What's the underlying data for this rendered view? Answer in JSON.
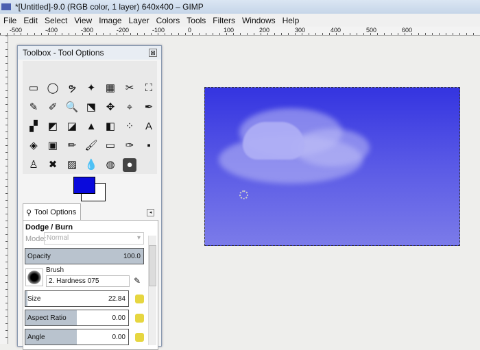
{
  "window": {
    "title": "*[Untitled]-9.0 (RGB color, 1 layer) 640x400 – GIMP"
  },
  "menu": [
    "File",
    "Edit",
    "Select",
    "View",
    "Image",
    "Layer",
    "Colors",
    "Tools",
    "Filters",
    "Windows",
    "Help"
  ],
  "ruler": {
    "labels": [
      "-500",
      "-400",
      "-300",
      "-200",
      "-100",
      "0",
      "100",
      "200",
      "300",
      "400",
      "500",
      "600"
    ]
  },
  "toolbox": {
    "title": "Toolbox - Tool Options",
    "close": "⊠",
    "tools": [
      "▭",
      "◯",
      "ຯ",
      "✦",
      "▦",
      "✂",
      "⛶",
      "✎",
      "✐",
      "🔍",
      "⬔",
      "✥",
      "⌖",
      "✒",
      "▞",
      "◩",
      "◪",
      "▲",
      "◧",
      "⁘",
      "A",
      "◈",
      "▣",
      "✏",
      "🖌",
      "▭",
      "✑",
      "▪",
      "♙",
      "✖",
      "▨",
      "💧",
      "◍",
      "●"
    ],
    "active_tool": 33,
    "fg_color": "#0a0adc",
    "bg_color": "#ffffff"
  },
  "tool_options": {
    "tab": "Tool Options",
    "heading": "Dodge / Burn",
    "mode_label": "Mode:",
    "mode_value": "Normal",
    "opacity": {
      "label": "Opacity",
      "value": "100.0",
      "fraction": 1.0
    },
    "brush": {
      "label": "Brush",
      "value": "2. Hardness 075"
    },
    "size": {
      "label": "Size",
      "value": "22.84",
      "fraction": 0.02
    },
    "aspect": {
      "label": "Aspect Ratio",
      "value": "0.00",
      "fraction": 0.5
    },
    "angle": {
      "label": "Angle",
      "value": "0.00",
      "fraction": 0.5
    }
  }
}
